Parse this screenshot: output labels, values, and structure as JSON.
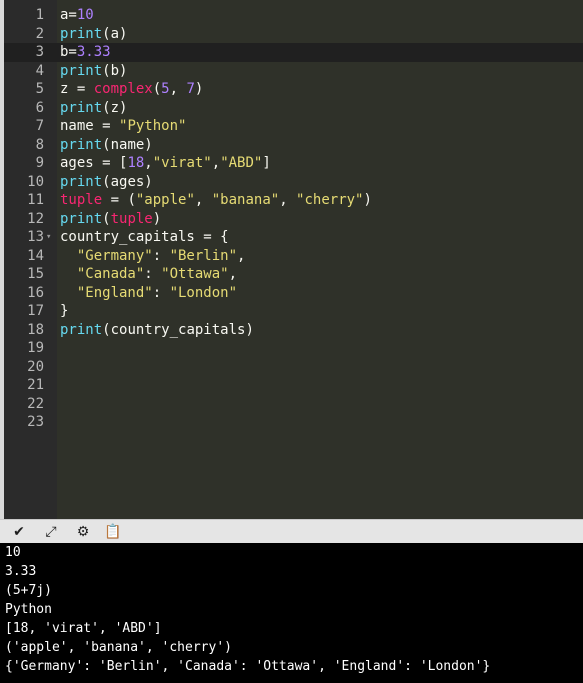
{
  "editor": {
    "line_numbers": [
      "1",
      "2",
      "3",
      "4",
      "5",
      "6",
      "7",
      "8",
      "9",
      "10",
      "11",
      "12",
      "13",
      "14",
      "15",
      "16",
      "17",
      "18",
      "19",
      "20",
      "21",
      "22",
      "23"
    ],
    "lines": [
      [
        {
          "t": "a=",
          "c": "punc"
        },
        {
          "t": "10",
          "c": "num"
        }
      ],
      [
        {
          "t": "print",
          "c": "fn"
        },
        {
          "t": "(a)",
          "c": "punc"
        }
      ],
      [
        {
          "t": "b=",
          "c": "punc"
        },
        {
          "t": "3.33",
          "c": "num"
        }
      ],
      [
        {
          "t": "print",
          "c": "fn"
        },
        {
          "t": "(b)",
          "c": "punc"
        }
      ],
      [
        {
          "t": "z = ",
          "c": "punc"
        },
        {
          "t": "complex",
          "c": "bad"
        },
        {
          "t": "(",
          "c": "punc"
        },
        {
          "t": "5",
          "c": "num"
        },
        {
          "t": ", ",
          "c": "punc"
        },
        {
          "t": "7",
          "c": "num"
        },
        {
          "t": ")",
          "c": "punc"
        }
      ],
      [
        {
          "t": "print",
          "c": "fn"
        },
        {
          "t": "(z)",
          "c": "punc"
        }
      ],
      [
        {
          "t": "name = ",
          "c": "punc"
        },
        {
          "t": "\"Python\"",
          "c": "str"
        }
      ],
      [
        {
          "t": "print",
          "c": "fn"
        },
        {
          "t": "(name)",
          "c": "punc"
        }
      ],
      [
        {
          "t": "ages = [",
          "c": "punc"
        },
        {
          "t": "18",
          "c": "num"
        },
        {
          "t": ",",
          "c": "punc"
        },
        {
          "t": "\"virat\"",
          "c": "str"
        },
        {
          "t": ",",
          "c": "punc"
        },
        {
          "t": "\"ABD\"",
          "c": "str"
        },
        {
          "t": "]",
          "c": "punc"
        }
      ],
      [
        {
          "t": "print",
          "c": "fn"
        },
        {
          "t": "(ages)",
          "c": "punc"
        }
      ],
      [
        {
          "t": "tuple",
          "c": "bad"
        },
        {
          "t": " = (",
          "c": "punc"
        },
        {
          "t": "\"apple\"",
          "c": "str"
        },
        {
          "t": ", ",
          "c": "punc"
        },
        {
          "t": "\"banana\"",
          "c": "str"
        },
        {
          "t": ", ",
          "c": "punc"
        },
        {
          "t": "\"cherry\"",
          "c": "str"
        },
        {
          "t": ")",
          "c": "punc"
        }
      ],
      [
        {
          "t": "print",
          "c": "fn"
        },
        {
          "t": "(",
          "c": "punc"
        },
        {
          "t": "tuple",
          "c": "bad"
        },
        {
          "t": ")",
          "c": "punc"
        }
      ],
      [
        {
          "t": "country_capitals = {",
          "c": "punc"
        }
      ],
      [
        {
          "t": "  ",
          "c": "punc"
        },
        {
          "t": "\"Germany\"",
          "c": "str"
        },
        {
          "t": ": ",
          "c": "punc"
        },
        {
          "t": "\"Berlin\"",
          "c": "str"
        },
        {
          "t": ",",
          "c": "punc"
        }
      ],
      [
        {
          "t": "  ",
          "c": "punc"
        },
        {
          "t": "\"Canada\"",
          "c": "str"
        },
        {
          "t": ": ",
          "c": "punc"
        },
        {
          "t": "\"Ottawa\"",
          "c": "str"
        },
        {
          "t": ",",
          "c": "punc"
        }
      ],
      [
        {
          "t": "  ",
          "c": "punc"
        },
        {
          "t": "\"England\"",
          "c": "str"
        },
        {
          "t": ": ",
          "c": "punc"
        },
        {
          "t": "\"London\"",
          "c": "str"
        }
      ],
      [
        {
          "t": "}",
          "c": "punc"
        }
      ],
      [
        {
          "t": "print",
          "c": "fn"
        },
        {
          "t": "(country_capitals)",
          "c": "punc"
        }
      ],
      [],
      [],
      [],
      [],
      []
    ],
    "active_line": "3",
    "fold_marker": "▾"
  },
  "toolbar": {
    "icons": [
      {
        "name": "chevron-down-icon",
        "glyph": "✔"
      },
      {
        "name": "expand-icon",
        "glyph": "⤢"
      },
      {
        "name": "gear-icon",
        "glyph": "⚙"
      },
      {
        "name": "clipboard-icon",
        "glyph": "📋"
      }
    ]
  },
  "console": {
    "lines": [
      "10",
      "3.33",
      "(5+7j)",
      "Python",
      "[18, 'virat', 'ABD']",
      "('apple', 'banana', 'cherry')",
      "{'Germany': 'Berlin', 'Canada': 'Ottawa', 'England': 'London'}"
    ]
  },
  "colors": {
    "editor_bg": "#2f3129",
    "gutter_bg": "#2b2b2b",
    "keyword_function": "#66d9ef",
    "number": "#ae81ff",
    "string": "#e6db74",
    "builtin_highlight": "#f92672",
    "console_bg": "#000000"
  }
}
